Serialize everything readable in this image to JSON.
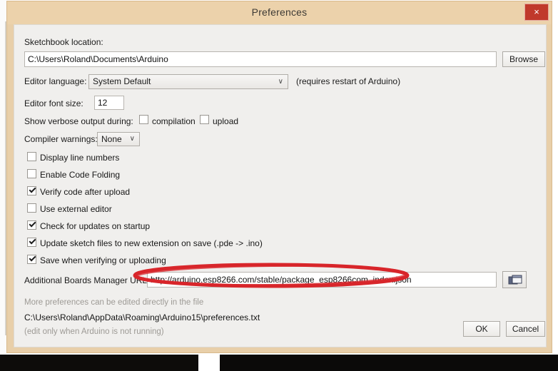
{
  "window": {
    "title": "Preferences",
    "close_label": "×",
    "close_icon": "close-icon"
  },
  "sketchbook": {
    "label": "Sketchbook location:",
    "value": "C:\\Users\\Roland\\Documents\\Arduino",
    "browse_label": "Browse"
  },
  "editor_language": {
    "label": "Editor language:",
    "value": "System Default",
    "caret": "∨",
    "note": "(requires restart of Arduino)"
  },
  "editor_font_size": {
    "label": "Editor font size:",
    "value": "12"
  },
  "verbose": {
    "label": "Show verbose output during:",
    "options": [
      {
        "label": "compilation",
        "checked": false
      },
      {
        "label": "upload",
        "checked": false
      }
    ]
  },
  "compiler_warnings": {
    "label": "Compiler warnings:",
    "value": "None",
    "caret": "∨"
  },
  "checkboxes": [
    {
      "label": "Display line numbers",
      "checked": false
    },
    {
      "label": "Enable Code Folding",
      "checked": false
    },
    {
      "label": "Verify code after upload",
      "checked": true
    },
    {
      "label": "Use external editor",
      "checked": false
    },
    {
      "label": "Check for updates on startup",
      "checked": true
    },
    {
      "label": "Update sketch files to new extension on save (.pde -> .ino)",
      "checked": true
    },
    {
      "label": "Save when verifying or uploading",
      "checked": true
    }
  ],
  "boards_manager": {
    "label": "Additional Boards Manager URLs:",
    "value": "http://arduino.esp8266.com/stable/package_esp8266com_index.json",
    "button_icon": "open-window-icon"
  },
  "footer": {
    "line1": "More preferences can be edited directly in the file",
    "path": "C:\\Users\\Roland\\AppData\\Roaming\\Arduino15\\preferences.txt",
    "line3": "(edit only when Arduino is not running)"
  },
  "actions": {
    "ok_label": "OK",
    "cancel_label": "Cancel"
  },
  "annotation": {
    "shape": "ellipse",
    "color": "#d8262b",
    "target": "Additional Boards Manager URLs field value"
  },
  "colors": {
    "title_bar": "#ecd2ab",
    "window_border": "#e8cfa9",
    "close_button": "#c0392b",
    "client_background": "#f0efed",
    "annotation_red": "#d8262b"
  }
}
